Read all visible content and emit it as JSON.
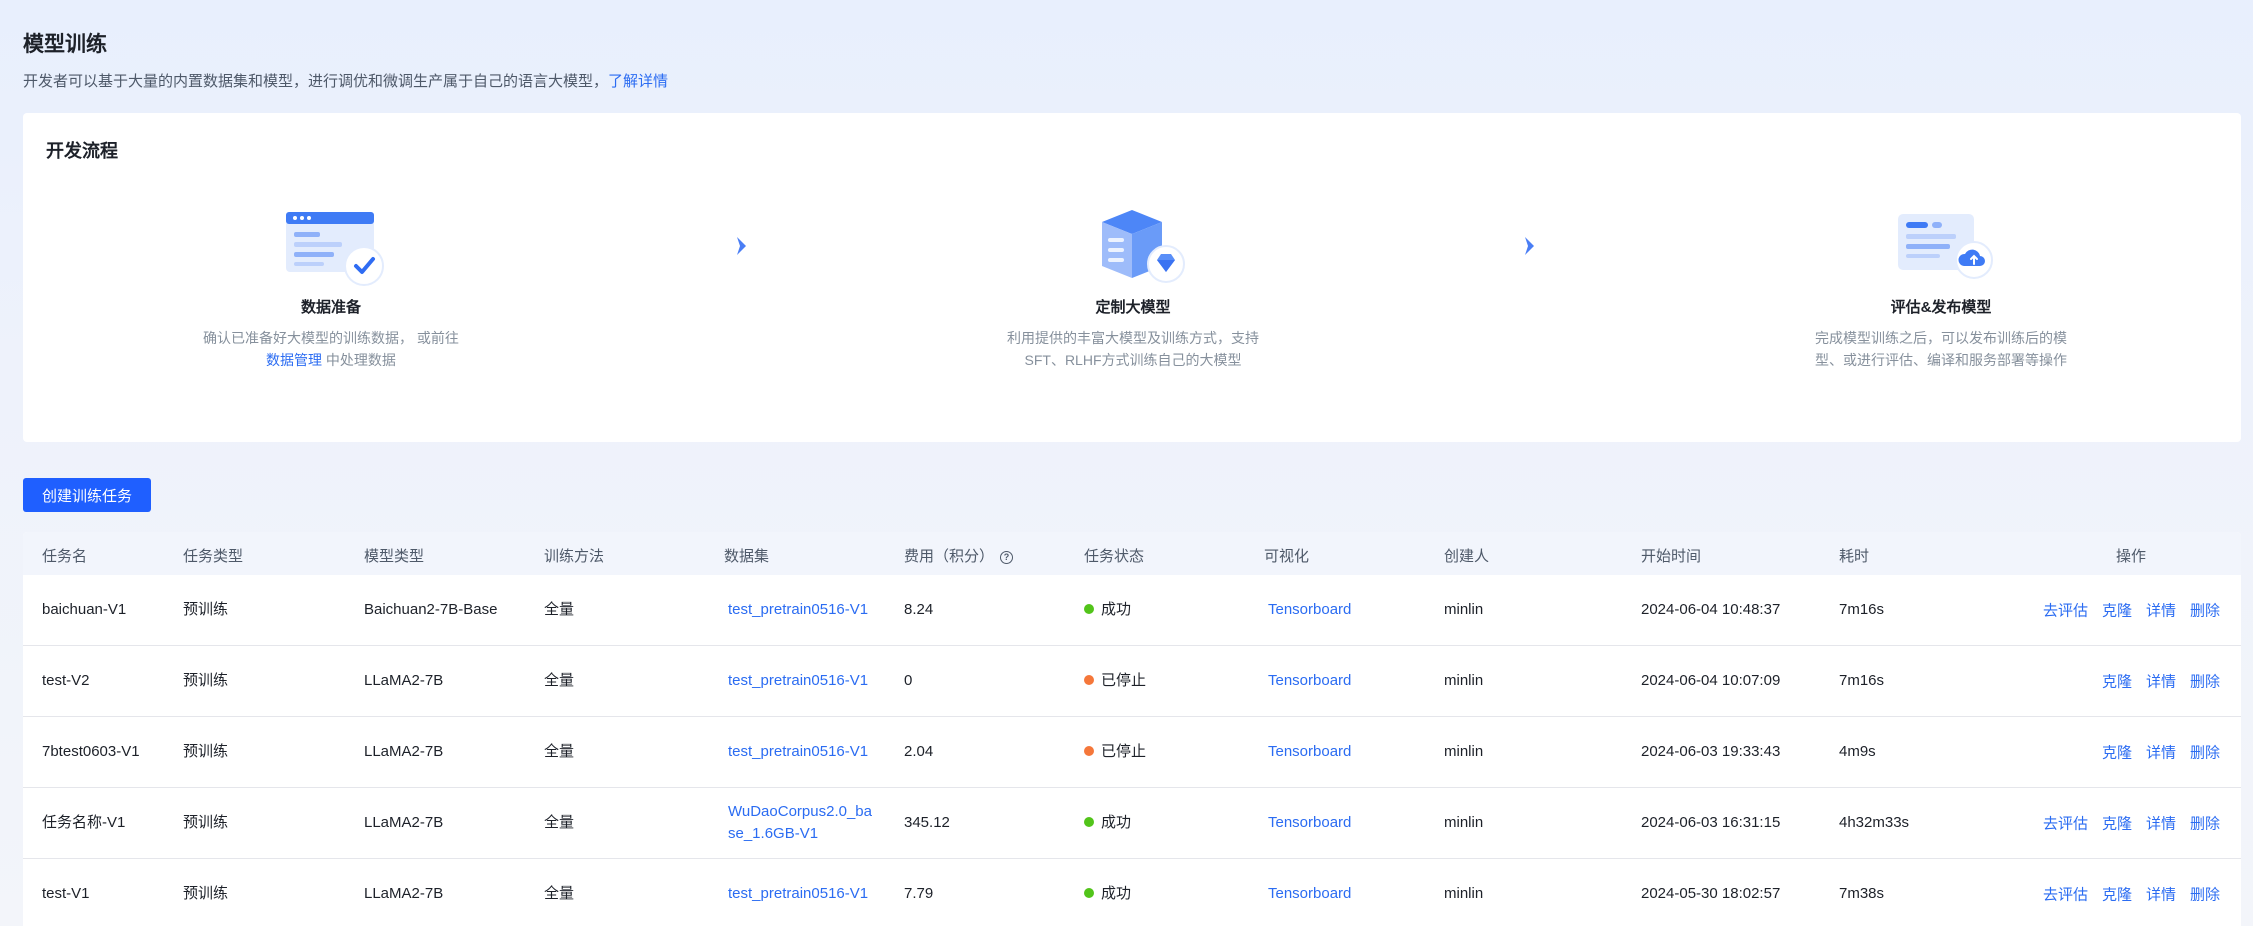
{
  "page": {
    "title": "模型训练",
    "description": "开发者可以基于大量的内置数据集和模型，进行调优和微调生产属于自己的语言大模型，",
    "learn_more": "了解详情"
  },
  "flow": {
    "title": "开发流程",
    "steps": [
      {
        "title": "数据准备",
        "desc_before": "确认已准备好大模型的训练数据， 或前往 ",
        "link": "数据管理",
        "desc_after": " 中处理数据",
        "icon": "data-prep-icon"
      },
      {
        "title": "定制大模型",
        "desc": "利用提供的丰富大模型及训练方式，支持SFT、RLHF方式训练自己的大模型",
        "icon": "custom-model-icon"
      },
      {
        "title": "评估&发布模型",
        "desc": "完成模型训练之后，可以发布训练后的模型、或进行评估、编译和服务部署等操作",
        "icon": "publish-model-icon"
      }
    ]
  },
  "create_button": "创建训练任务",
  "table": {
    "headers": {
      "name": "任务名",
      "task_type": "任务类型",
      "model_type": "模型类型",
      "method": "训练方法",
      "dataset": "数据集",
      "cost": "费用（积分）",
      "status": "任务状态",
      "visual": "可视化",
      "creator": "创建人",
      "start_time": "开始时间",
      "duration": "耗时",
      "actions": "操作"
    },
    "rows": [
      {
        "name": "baichuan-V1",
        "task_type": "预训练",
        "model_type": "Baichuan2-7B-Base",
        "method": "全量",
        "dataset": "test_pretrain0516-V1",
        "cost": "8.24",
        "status": "成功",
        "status_color": "#52c41a",
        "visual": "Tensorboard",
        "creator": "minlin",
        "start_time": "2024-06-04 10:48:37",
        "duration": "7m16s",
        "actions": [
          "去评估",
          "克隆",
          "详情",
          "删除"
        ]
      },
      {
        "name": "test-V2",
        "task_type": "预训练",
        "model_type": "LLaMA2-7B",
        "method": "全量",
        "dataset": "test_pretrain0516-V1",
        "cost": "0",
        "status": "已停止",
        "status_color": "#f5773a",
        "visual": "Tensorboard",
        "creator": "minlin",
        "start_time": "2024-06-04 10:07:09",
        "duration": "7m16s",
        "actions": [
          "克隆",
          "详情",
          "删除"
        ]
      },
      {
        "name": "7btest0603-V1",
        "task_type": "预训练",
        "model_type": "LLaMA2-7B",
        "method": "全量",
        "dataset": "test_pretrain0516-V1",
        "cost": "2.04",
        "status": "已停止",
        "status_color": "#f5773a",
        "visual": "Tensorboard",
        "creator": "minlin",
        "start_time": "2024-06-03 19:33:43",
        "duration": "4m9s",
        "actions": [
          "克隆",
          "详情",
          "删除"
        ]
      },
      {
        "name": "任务名称-V1",
        "task_type": "预训练",
        "model_type": "LLaMA2-7B",
        "method": "全量",
        "dataset": "WuDaoCorpus2.0_base_1.6GB-V1",
        "cost": "345.12",
        "status": "成功",
        "status_color": "#52c41a",
        "visual": "Tensorboard",
        "creator": "minlin",
        "start_time": "2024-06-03 16:31:15",
        "duration": "4h32m33s",
        "actions": [
          "去评估",
          "克隆",
          "详情",
          "删除"
        ]
      },
      {
        "name": "test-V1",
        "task_type": "预训练",
        "model_type": "LLaMA2-7B",
        "method": "全量",
        "dataset": "test_pretrain0516-V1",
        "cost": "7.79",
        "status": "成功",
        "status_color": "#52c41a",
        "visual": "Tensorboard",
        "creator": "minlin",
        "start_time": "2024-05-30 18:02:57",
        "duration": "7m38s",
        "actions": [
          "去评估",
          "克隆",
          "详情",
          "删除"
        ]
      }
    ]
  }
}
